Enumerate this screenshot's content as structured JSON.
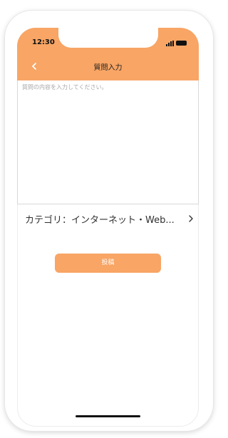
{
  "status_bar": {
    "time": "12:30"
  },
  "header": {
    "title": "質問入力",
    "background_color": "#f8a565"
  },
  "question": {
    "placeholder": "質問の内容を入力してください。",
    "value": ""
  },
  "category": {
    "label": "カテゴリ：インターネット・Web..."
  },
  "actions": {
    "post_label": "投稿"
  },
  "icons": {
    "back": "chevron-left-icon",
    "category_arrow": "chevron-right-icon",
    "signal": "signal-icon",
    "battery": "battery-icon"
  }
}
